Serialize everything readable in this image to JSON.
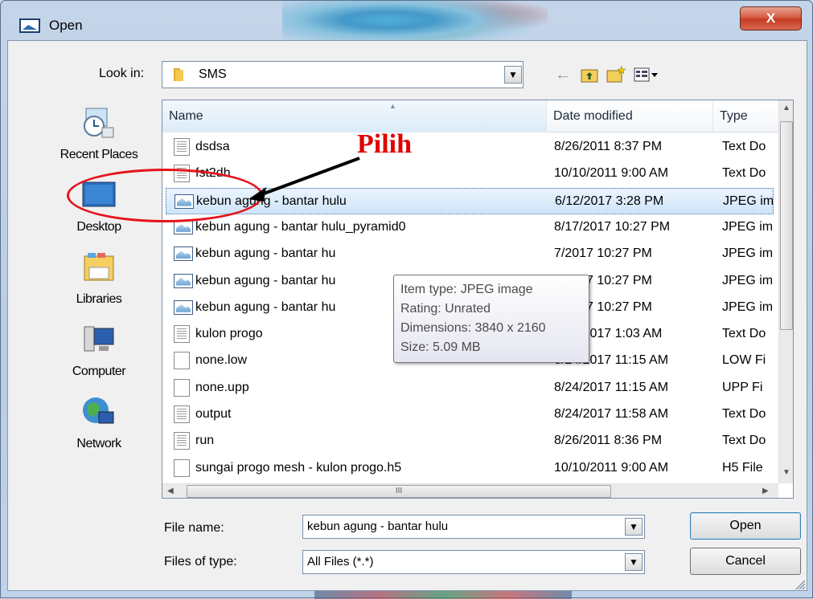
{
  "window": {
    "title": "Open",
    "close_label": "X"
  },
  "look_in": {
    "label": "Look in:",
    "value": "SMS"
  },
  "toolbar": {
    "back_icon": "back-arrow-icon",
    "up_icon": "up-folder-icon",
    "new_folder_icon": "new-folder-icon",
    "views_icon": "views-menu-icon"
  },
  "places": [
    {
      "label": "Recent Places",
      "icon": "recent-places-icon"
    },
    {
      "label": "Desktop",
      "icon": "desktop-icon"
    },
    {
      "label": "Libraries",
      "icon": "libraries-icon"
    },
    {
      "label": "Computer",
      "icon": "computer-icon"
    },
    {
      "label": "Network",
      "icon": "network-icon"
    }
  ],
  "columns": {
    "name": "Name",
    "date": "Date modified",
    "type": "Type"
  },
  "files": [
    {
      "name": "dsdsa",
      "date": "8/26/2011 8:37 PM",
      "type": "Text Do",
      "icon": "text-file-icon"
    },
    {
      "name": "fst2dh",
      "date": "10/10/2011 9:00 AM",
      "type": "Text Do",
      "icon": "text-file-icon"
    },
    {
      "name": "kebun agung - bantar hulu",
      "date": "6/12/2017 3:28 PM",
      "type": "JPEG im",
      "icon": "image-file-icon",
      "selected": true
    },
    {
      "name": "kebun agung - bantar hulu_pyramid0",
      "date": "8/17/2017 10:27 PM",
      "type": "JPEG im",
      "icon": "image-file-icon"
    },
    {
      "name": "kebun agung - bantar hu",
      "date": "7/2017 10:27 PM",
      "type": "JPEG im",
      "icon": "image-file-icon"
    },
    {
      "name": "kebun agung - bantar hu",
      "date": "7/2017 10:27 PM",
      "type": "JPEG im",
      "icon": "image-file-icon"
    },
    {
      "name": "kebun agung - bantar hu",
      "date": "7/2017 10:27 PM",
      "type": "JPEG im",
      "icon": "image-file-icon"
    },
    {
      "name": "kulon progo",
      "date": "8/15/2017 1:03 AM",
      "type": "Text Do",
      "icon": "text-file-icon"
    },
    {
      "name": "none.low",
      "date": "8/24/2017 11:15 AM",
      "type": "LOW Fi",
      "icon": "blank-file-icon"
    },
    {
      "name": "none.upp",
      "date": "8/24/2017 11:15 AM",
      "type": "UPP Fi",
      "icon": "blank-file-icon"
    },
    {
      "name": "output",
      "date": "8/24/2017 11:58 AM",
      "type": "Text Do",
      "icon": "text-file-icon"
    },
    {
      "name": "run",
      "date": "8/26/2011 8:36 PM",
      "type": "Text Do",
      "icon": "text-file-icon"
    },
    {
      "name": "sungai progo mesh - kulon progo.h5",
      "date": "10/10/2011 9:00 AM",
      "type": "H5 File",
      "icon": "blank-file-icon"
    }
  ],
  "tooltip": {
    "lines": [
      "Item type: JPEG image",
      "Rating: Unrated",
      "Dimensions: 3840 x 2160",
      "Size: 5.09 MB"
    ]
  },
  "scrollbar": {
    "h_grip": "III"
  },
  "annotation": {
    "text": "Pilih",
    "color": "#e00000"
  },
  "file_name": {
    "label": "File name:",
    "value": "kebun agung - bantar hulu"
  },
  "file_type": {
    "label": "Files of type:",
    "value": "All Files (*.*)"
  },
  "buttons": {
    "open": "Open",
    "cancel": "Cancel"
  }
}
